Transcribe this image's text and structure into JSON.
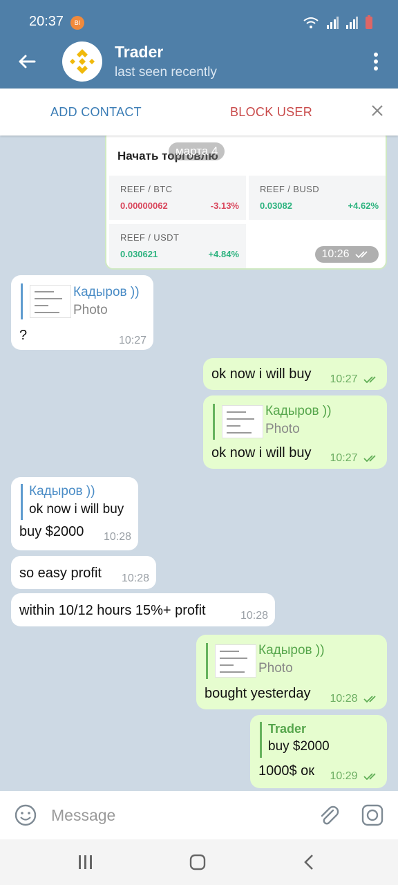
{
  "status": {
    "time": "20:37",
    "notif": "BI"
  },
  "header": {
    "title": "Trader",
    "subtitle": "last seen recently"
  },
  "actions": {
    "add_contact": "ADD CONTACT",
    "block_user": "BLOCK USER"
  },
  "card": {
    "title": "Начать торговлю",
    "date_chip": "марта 4",
    "time": "10:26",
    "cells": [
      {
        "pair": "REEF / BTC",
        "price": "0.00000062",
        "change": "-3.13%"
      },
      {
        "pair": "REEF / BUSD",
        "price": "0.03082",
        "change": "+4.62%"
      },
      {
        "pair": "REEF / USDT",
        "price": "0.030621",
        "change": "+4.84%"
      }
    ]
  },
  "messages": [
    {
      "reply_name": "Кадыров ))",
      "reply_text": "Photo",
      "text": "?",
      "time": "10:27"
    },
    {
      "text": "ok now i will buy",
      "time": "10:27"
    },
    {
      "reply_name": "Кадыров ))",
      "reply_text": "Photo",
      "text": "ok now i will buy",
      "time": "10:27"
    },
    {
      "reply_name": "Кадыров ))",
      "reply_text": "ok now i will buy",
      "text": "buy $2000",
      "time": "10:28"
    },
    {
      "text": "so easy profit",
      "time": "10:28"
    },
    {
      "text": "within 10/12 hours 15%+ profit",
      "time": "10:28"
    },
    {
      "reply_name": "Кадыров ))",
      "reply_text": "Photo",
      "text": "bought yesterday",
      "time": "10:28"
    },
    {
      "reply_name": "Trader",
      "reply_text": "buy $2000",
      "text": "1000$ ок",
      "time": "10:29"
    }
  ],
  "input": {
    "placeholder": "Message"
  },
  "icons": [
    "back-arrow-icon",
    "menu-icon",
    "close-icon",
    "emoji-icon",
    "attach-icon",
    "camera-icon",
    "double-check-icon",
    "wifi-icon",
    "signal-icon",
    "battery-icon"
  ],
  "colors": {
    "header": "#4f7fa8",
    "incoming": "#ffffff",
    "outgoing": "#e6fdcf",
    "accent": "#3a7cb5",
    "danger": "#c94a4a"
  }
}
